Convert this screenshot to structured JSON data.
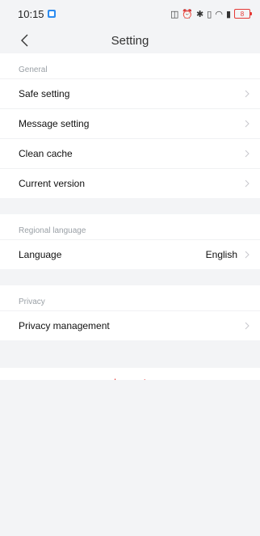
{
  "status": {
    "time": "10:15",
    "battery": "8"
  },
  "header": {
    "title": "Setting"
  },
  "general": {
    "title": "General",
    "items": [
      {
        "label": "Safe setting"
      },
      {
        "label": "Message setting"
      },
      {
        "label": "Clean cache"
      },
      {
        "label": "Current version"
      }
    ]
  },
  "regional": {
    "title": "Regional language",
    "item": {
      "label": "Language",
      "value": "English"
    }
  },
  "privacy": {
    "title": "Privacy",
    "item": {
      "label": "Privacy management"
    }
  },
  "actions": {
    "logout": "Log out"
  },
  "colors": {
    "accent": "#e53935",
    "background": "#f3f4f6",
    "divider": "#f0f1f3"
  }
}
